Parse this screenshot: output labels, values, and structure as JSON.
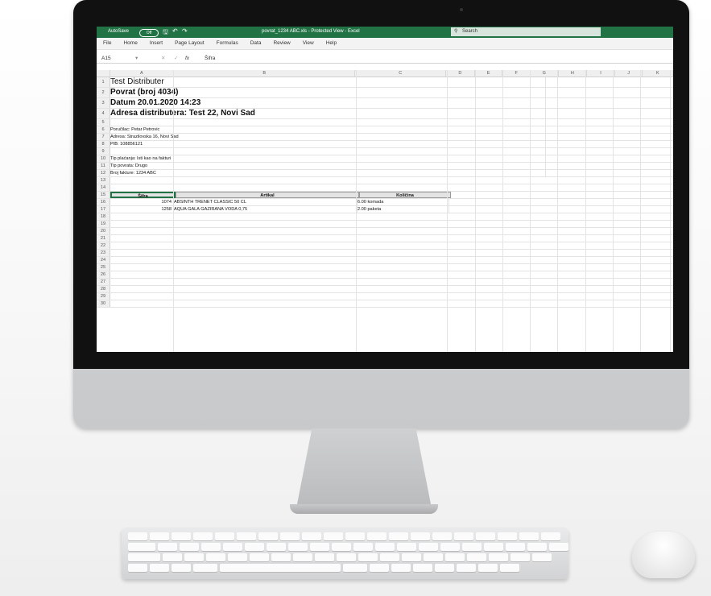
{
  "excel": {
    "autosave_label": "AutoSave",
    "autosave_state": "Off",
    "title": "povrat_1234 ABC.xls  -  Protected View  -  Excel",
    "search_placeholder": "Search",
    "menu": [
      "File",
      "Home",
      "Insert",
      "Page Layout",
      "Formulas",
      "Data",
      "Review",
      "View",
      "Help"
    ],
    "name_box": "A15",
    "formula_fx": "fx",
    "formula_value": "Šifra",
    "columns": [
      "A",
      "B",
      "C",
      "D",
      "E",
      "F",
      "G",
      "H",
      "I",
      "J",
      "K"
    ],
    "rows": {
      "r1": "Test Distributer",
      "r2": "Povrat (broj 4034)",
      "r3": "Datum 20.01.2020 14:23",
      "r4": "Adresa distributera: Test 22, Novi Sad",
      "r6": "Poručilac: Petar Petrovic",
      "r7": "Adresa: Strazilovska 16, Novi Sad",
      "r8": "PIB: 108856121",
      "r10": "Tip plaćanja: Isti kao na fakturi",
      "r11": "Tip povrata: Drugo",
      "r12": "Broj fakture: 1234 ABC"
    },
    "table_header": {
      "sifra": "Šifra",
      "artikal": "Artikal",
      "kolicina": "Količina"
    },
    "items": [
      {
        "sifra": "1074",
        "artikal": "ABSINTH TRENET CLASSIC 50 CL",
        "kolicina": "6.00 komada"
      },
      {
        "sifra": "1258",
        "artikal": "AQUA GALA GAZIRANA VODA 0,75",
        "kolicina": "2.00 paketa"
      }
    ],
    "row_numbers": [
      "1",
      "2",
      "3",
      "4",
      "5",
      "6",
      "7",
      "8",
      "9",
      "10",
      "11",
      "12",
      "13",
      "14",
      "15",
      "16",
      "17",
      "18",
      "19",
      "20",
      "21",
      "22",
      "23",
      "24",
      "25",
      "26",
      "27",
      "28",
      "29",
      "30"
    ],
    "accent": "#217346"
  }
}
